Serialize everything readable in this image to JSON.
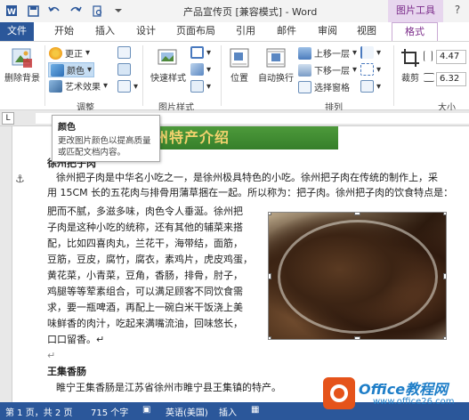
{
  "window": {
    "title": "产品宣传页 [兼容模式] - Word",
    "context_tool": "图片工具"
  },
  "tabs": [
    "文件",
    "开始",
    "插入",
    "设计",
    "页面布局",
    "引用",
    "邮件",
    "审阅",
    "视图",
    "格式"
  ],
  "ribbon": {
    "remove_bg": "删除背景",
    "corrections": "更正",
    "color": "颜色",
    "art_effects": "艺术效果",
    "adjust_group": "调整",
    "quick_styles": "快速样式",
    "picture_styles_group": "图片样式",
    "position": "位置",
    "wrap_text": "自动换行",
    "bring_forward": "上移一层",
    "send_backward": "下移一层",
    "selection_pane": "选择窗格",
    "arrange_group": "排列",
    "crop": "裁剪",
    "height_value": "4.47",
    "width_value": "6.32",
    "size_group": "大小"
  },
  "tooltip": {
    "title": "颜色",
    "body": "更改图片颜色以提高质量或匹配文档内容。"
  },
  "document": {
    "banner_title": "徐州特产介绍",
    "h_bazi": "徐州把子肉",
    "p1_line1": "徐州把子肉是中华名小吃之一，是徐州极具特色的小吃。徐州把子肉在传统的制作上，采",
    "p1_line2": "用 15CM 长的五花肉与排骨用蒲草捆在一起。所以称为：把子肉。徐州把子肉的饮食特点是：",
    "p1_l3": "肥而不腻，多滋多味，肉色令人垂涎。徐州把",
    "p1_l4": "子肉是这种小吃的统称，还有其他的辅菜来搭",
    "p1_l5": "配，比如四喜肉丸，兰花干，海带结，面筋，",
    "p1_l6": "豆筋，豆皮，腐竹，腐衣，素鸡片，虎皮鸡蛋，",
    "p1_l7": "黄花菜，小青菜，豆角，香肠，排骨，肘子，",
    "p1_l8": "鸡腿等等荤素组合，可以满足顾客不同饮食需",
    "p1_l9": "求，要一瓶啤酒，再配上一碗白米干饭浇上美",
    "p1_l10": "味鲜香的肉汁，吃起来满嘴流油，回味悠长，",
    "p1_l11": "口口留香。↵",
    "empty_mark": "↵",
    "h_wangji": "王集香肠",
    "p2_line1": "睢宁王集香肠是江苏省徐州市睢宁县王集镇的特产。"
  },
  "statusbar": {
    "page": "第 1 页，共 2 页",
    "words": "715 个字",
    "language": "英语(美国)",
    "mode": "插入"
  },
  "watermark": {
    "brand": "Office教程网",
    "url": "www.office26.com"
  },
  "colors": {
    "word_blue": "#2b579a",
    "context_purple": "#7b2c8a",
    "banner_green": "#367f2a",
    "banner_text": "#f2d26e"
  }
}
